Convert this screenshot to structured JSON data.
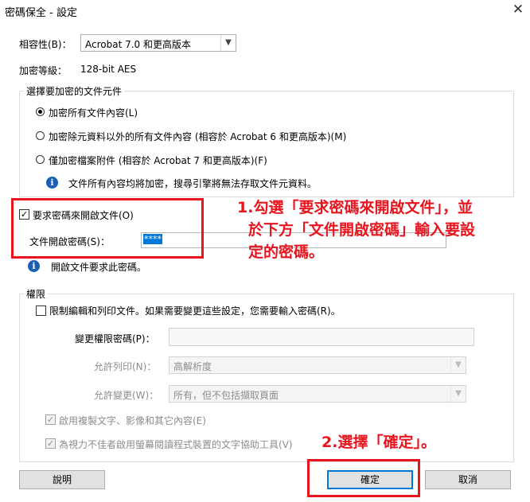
{
  "window": {
    "title": "密碼保全 - 設定",
    "close_glyph": "✕"
  },
  "compatibility": {
    "label": "相容性(B)：",
    "value": "Acrobat 7.0 和更高版本"
  },
  "encryption_level": {
    "label": "加密等級：",
    "value": "128-bit AES"
  },
  "encrypt_section": {
    "legend": "選擇要加密的文件元件",
    "options": [
      "加密所有文件內容(L)",
      "加密除元資料以外的所有文件內容 (相容於 Acrobat 6 和更高版本)(M)",
      "僅加密檔案附件 (相容於 Acrobat 7 和更高版本)(F)"
    ],
    "selected_index": 0,
    "info": "文件所有內容均將加密，搜尋引擎將無法存取文件元資料。"
  },
  "open_password": {
    "require_label": "要求密碼來開啟文件(O)",
    "require_checked": true,
    "field_label": "文件開啟密碼(S)：",
    "field_value": "****",
    "info": "開啟文件要求此密碼。"
  },
  "permissions": {
    "legend": "權限",
    "restrict_label": "限制編輯和列印文件。如果需要變更這些設定，您需要輸入密碼(R)。",
    "change_pw_label": "變更權限密碼(P)：",
    "print_label": "允許列印(N)：",
    "print_value": "高解析度",
    "change_label": "允許變更(W)：",
    "change_value": "所有，但不包括擷取頁面",
    "copy_label": "啟用複製文字、影像和其它內容(E)",
    "screen_reader_label": "為視力不佳者啟用螢幕閱讀程式裝置的文字協助工具(V)"
  },
  "buttons": {
    "help": "說明",
    "ok": "確定",
    "cancel": "取消"
  },
  "annotations": {
    "step1_line1": "1.勾選「要求密碼來開啟文件」，並",
    "step1_line2": "於下方「文件開啟密碼」輸入要設",
    "step1_line3": "定的密碼。",
    "step2": "2.選擇「確定」。"
  },
  "colors": {
    "annotation_red": "#e8141e",
    "default_button_blue": "#0078d7",
    "info_blue": "#1a5fb4"
  }
}
